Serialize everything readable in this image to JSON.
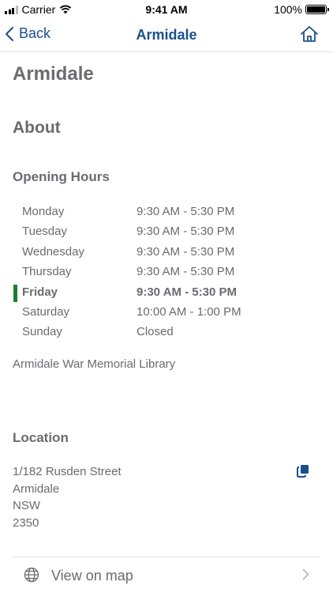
{
  "status_bar": {
    "carrier": "Carrier",
    "time": "9:41 AM",
    "battery": "100%"
  },
  "nav": {
    "back_label": "Back",
    "title": "Armidale"
  },
  "page": {
    "title": "Armidale",
    "about_heading": "About",
    "hours_heading": "Opening Hours"
  },
  "hours": [
    {
      "day": "Monday",
      "time": "9:30 AM - 5:30 PM"
    },
    {
      "day": "Tuesday",
      "time": "9:30 AM - 5:30 PM"
    },
    {
      "day": "Wednesday",
      "time": "9:30 AM - 5:30 PM"
    },
    {
      "day": "Thursday",
      "time": "9:30 AM - 5:30 PM"
    },
    {
      "day": "Friday",
      "time": "9:30 AM - 5:30 PM"
    },
    {
      "day": "Saturday",
      "time": "10:00 AM - 1:00 PM"
    },
    {
      "day": "Sunday",
      "time": "Closed"
    }
  ],
  "today": "Friday",
  "library_name": "Armidale War Memorial Library",
  "location": {
    "heading": "Location",
    "address_lines": [
      "1/182 Rusden Street",
      "Armidale",
      "NSW",
      "2350"
    ],
    "map_label": "View on map"
  },
  "icons": {
    "back": "chevron-left-icon",
    "home": "home-icon",
    "copy": "copy-icon",
    "globe": "globe-icon",
    "chevron": "chevron-right-icon"
  },
  "colors": {
    "accent": "#1a4f8c",
    "today_marker": "#1e7d32",
    "text": "#6b6b70"
  }
}
